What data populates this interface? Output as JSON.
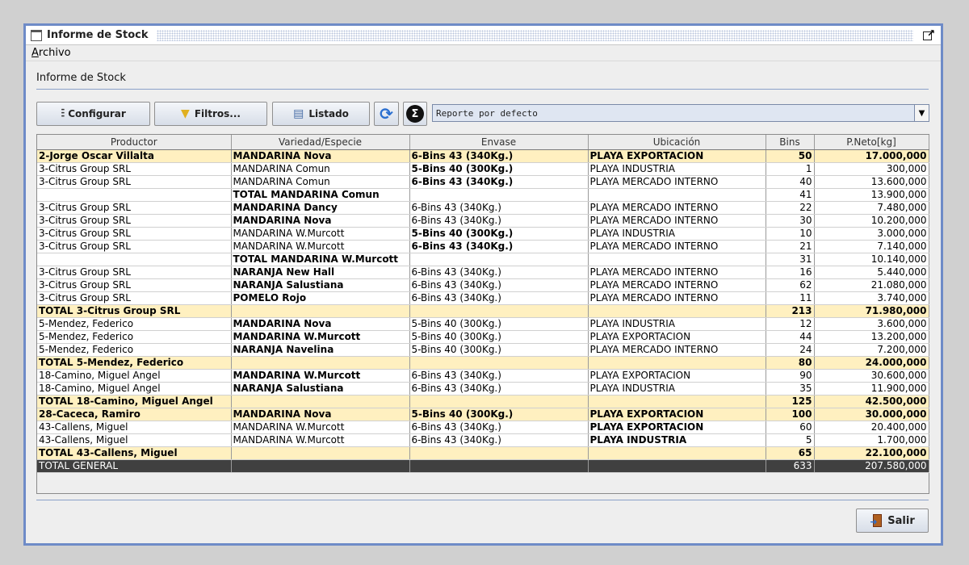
{
  "window": {
    "title": "Informe de Stock"
  },
  "menu": {
    "archivo": "Archivo"
  },
  "panel": {
    "title": "Informe de Stock"
  },
  "toolbar": {
    "configurar": "Configurar",
    "filtros": "Filtros...",
    "listado": "Listado",
    "sigma": "Σ",
    "report_selected": "Reporte por defecto"
  },
  "table": {
    "headers": [
      "Productor",
      "Variedad/Especie",
      "Envase",
      "Ubicación",
      "Bins",
      "P.Neto[kg]"
    ],
    "rows": [
      {
        "type": "hl",
        "bold": [
          true,
          true,
          true,
          true,
          true,
          true
        ],
        "cells": [
          "2-Jorge Oscar Villalta",
          "MANDARINA Nova",
          "6-Bins 43 (340Kg.)",
          "PLAYA EXPORTACION",
          "50",
          "17.000,000"
        ]
      },
      {
        "type": "",
        "bold": [
          false,
          false,
          true,
          false,
          false,
          false
        ],
        "cells": [
          "3-Citrus Group SRL",
          "MANDARINA Comun",
          "5-Bins 40 (300Kg.)",
          "PLAYA INDUSTRIA",
          "1",
          "300,000"
        ]
      },
      {
        "type": "",
        "bold": [
          false,
          false,
          true,
          false,
          false,
          false
        ],
        "cells": [
          "3-Citrus Group SRL",
          "MANDARINA Comun",
          "6-Bins 43 (340Kg.)",
          "PLAYA MERCADO INTERNO",
          "40",
          "13.600,000"
        ]
      },
      {
        "type": "",
        "bold": [
          false,
          true,
          false,
          false,
          false,
          false
        ],
        "cells": [
          "",
          "TOTAL MANDARINA Comun",
          "",
          "",
          "41",
          "13.900,000"
        ]
      },
      {
        "type": "",
        "bold": [
          false,
          true,
          false,
          false,
          false,
          false
        ],
        "cells": [
          "3-Citrus Group SRL",
          "MANDARINA Dancy",
          "6-Bins 43 (340Kg.)",
          "PLAYA MERCADO INTERNO",
          "22",
          "7.480,000"
        ]
      },
      {
        "type": "",
        "bold": [
          false,
          true,
          false,
          false,
          false,
          false
        ],
        "cells": [
          "3-Citrus Group SRL",
          "MANDARINA Nova",
          "6-Bins 43 (340Kg.)",
          "PLAYA MERCADO INTERNO",
          "30",
          "10.200,000"
        ]
      },
      {
        "type": "",
        "bold": [
          false,
          false,
          true,
          false,
          false,
          false
        ],
        "cells": [
          "3-Citrus Group SRL",
          "MANDARINA W.Murcott",
          "5-Bins 40 (300Kg.)",
          "PLAYA INDUSTRIA",
          "10",
          "3.000,000"
        ]
      },
      {
        "type": "",
        "bold": [
          false,
          false,
          true,
          false,
          false,
          false
        ],
        "cells": [
          "3-Citrus Group SRL",
          "MANDARINA W.Murcott",
          "6-Bins 43 (340Kg.)",
          "PLAYA MERCADO INTERNO",
          "21",
          "7.140,000"
        ]
      },
      {
        "type": "",
        "bold": [
          false,
          true,
          false,
          false,
          false,
          false
        ],
        "cells": [
          "",
          "TOTAL MANDARINA W.Murcott",
          "",
          "",
          "31",
          "10.140,000"
        ]
      },
      {
        "type": "",
        "bold": [
          false,
          true,
          false,
          false,
          false,
          false
        ],
        "cells": [
          "3-Citrus Group SRL",
          "NARANJA New Hall",
          "6-Bins 43 (340Kg.)",
          "PLAYA MERCADO INTERNO",
          "16",
          "5.440,000"
        ]
      },
      {
        "type": "",
        "bold": [
          false,
          true,
          false,
          false,
          false,
          false
        ],
        "cells": [
          "3-Citrus Group SRL",
          "NARANJA Salustiana",
          "6-Bins 43 (340Kg.)",
          "PLAYA MERCADO INTERNO",
          "62",
          "21.080,000"
        ]
      },
      {
        "type": "",
        "bold": [
          false,
          true,
          false,
          false,
          false,
          false
        ],
        "cells": [
          "3-Citrus Group SRL",
          "POMELO Rojo",
          "6-Bins 43 (340Kg.)",
          "PLAYA MERCADO INTERNO",
          "11",
          "3.740,000"
        ]
      },
      {
        "type": "hl",
        "bold": [
          true,
          true,
          true,
          true,
          true,
          true
        ],
        "cells": [
          "TOTAL 3-Citrus Group SRL",
          "",
          "",
          "",
          "213",
          "71.980,000"
        ]
      },
      {
        "type": "",
        "bold": [
          false,
          true,
          false,
          false,
          false,
          false
        ],
        "cells": [
          "5-Mendez, Federico",
          "MANDARINA Nova",
          "5-Bins 40 (300Kg.)",
          "PLAYA INDUSTRIA",
          "12",
          "3.600,000"
        ]
      },
      {
        "type": "",
        "bold": [
          false,
          true,
          false,
          false,
          false,
          false
        ],
        "cells": [
          "5-Mendez, Federico",
          "MANDARINA W.Murcott",
          "5-Bins 40 (300Kg.)",
          "PLAYA EXPORTACION",
          "44",
          "13.200,000"
        ]
      },
      {
        "type": "",
        "bold": [
          false,
          true,
          false,
          false,
          false,
          false
        ],
        "cells": [
          "5-Mendez, Federico",
          "NARANJA Navelina",
          "5-Bins 40 (300Kg.)",
          "PLAYA MERCADO INTERNO",
          "24",
          "7.200,000"
        ]
      },
      {
        "type": "hl",
        "bold": [
          true,
          true,
          true,
          true,
          true,
          true
        ],
        "cells": [
          "TOTAL 5-Mendez, Federico",
          "",
          "",
          "",
          "80",
          "24.000,000"
        ]
      },
      {
        "type": "",
        "bold": [
          false,
          true,
          false,
          false,
          false,
          false
        ],
        "cells": [
          "18-Camino, Miguel Angel",
          "MANDARINA W.Murcott",
          "6-Bins 43 (340Kg.)",
          "PLAYA EXPORTACION",
          "90",
          "30.600,000"
        ]
      },
      {
        "type": "",
        "bold": [
          false,
          true,
          false,
          false,
          false,
          false
        ],
        "cells": [
          "18-Camino, Miguel Angel",
          "NARANJA Salustiana",
          "6-Bins 43 (340Kg.)",
          "PLAYA INDUSTRIA",
          "35",
          "11.900,000"
        ]
      },
      {
        "type": "hl",
        "bold": [
          true,
          true,
          true,
          true,
          true,
          true
        ],
        "cells": [
          "TOTAL 18-Camino, Miguel Angel",
          "",
          "",
          "",
          "125",
          "42.500,000"
        ]
      },
      {
        "type": "hl",
        "bold": [
          true,
          true,
          true,
          true,
          true,
          true
        ],
        "cells": [
          "28-Caceca, Ramiro",
          "MANDARINA Nova",
          "5-Bins 40 (300Kg.)",
          "PLAYA EXPORTACION",
          "100",
          "30.000,000"
        ]
      },
      {
        "type": "",
        "bold": [
          false,
          false,
          false,
          true,
          false,
          false
        ],
        "cells": [
          "43-Callens, Miguel",
          "MANDARINA W.Murcott",
          "6-Bins 43 (340Kg.)",
          "PLAYA EXPORTACION",
          "60",
          "20.400,000"
        ]
      },
      {
        "type": "",
        "bold": [
          false,
          false,
          false,
          true,
          false,
          false
        ],
        "cells": [
          "43-Callens, Miguel",
          "MANDARINA W.Murcott",
          "6-Bins 43 (340Kg.)",
          "PLAYA INDUSTRIA",
          "5",
          "1.700,000"
        ]
      },
      {
        "type": "hl",
        "bold": [
          true,
          true,
          true,
          true,
          true,
          true
        ],
        "cells": [
          "TOTAL 43-Callens, Miguel",
          "",
          "",
          "",
          "65",
          "22.100,000"
        ]
      },
      {
        "type": "gt",
        "bold": [
          false,
          false,
          false,
          false,
          false,
          false
        ],
        "cells": [
          "TOTAL GENERAL",
          "",
          "",
          "",
          "633",
          "207.580,000"
        ]
      }
    ]
  },
  "footer": {
    "salir": "Salir"
  },
  "colors": {
    "highlight_row": "#fff0c0",
    "grand_total_row": "#404040",
    "window_border": "#6e8bc7"
  }
}
